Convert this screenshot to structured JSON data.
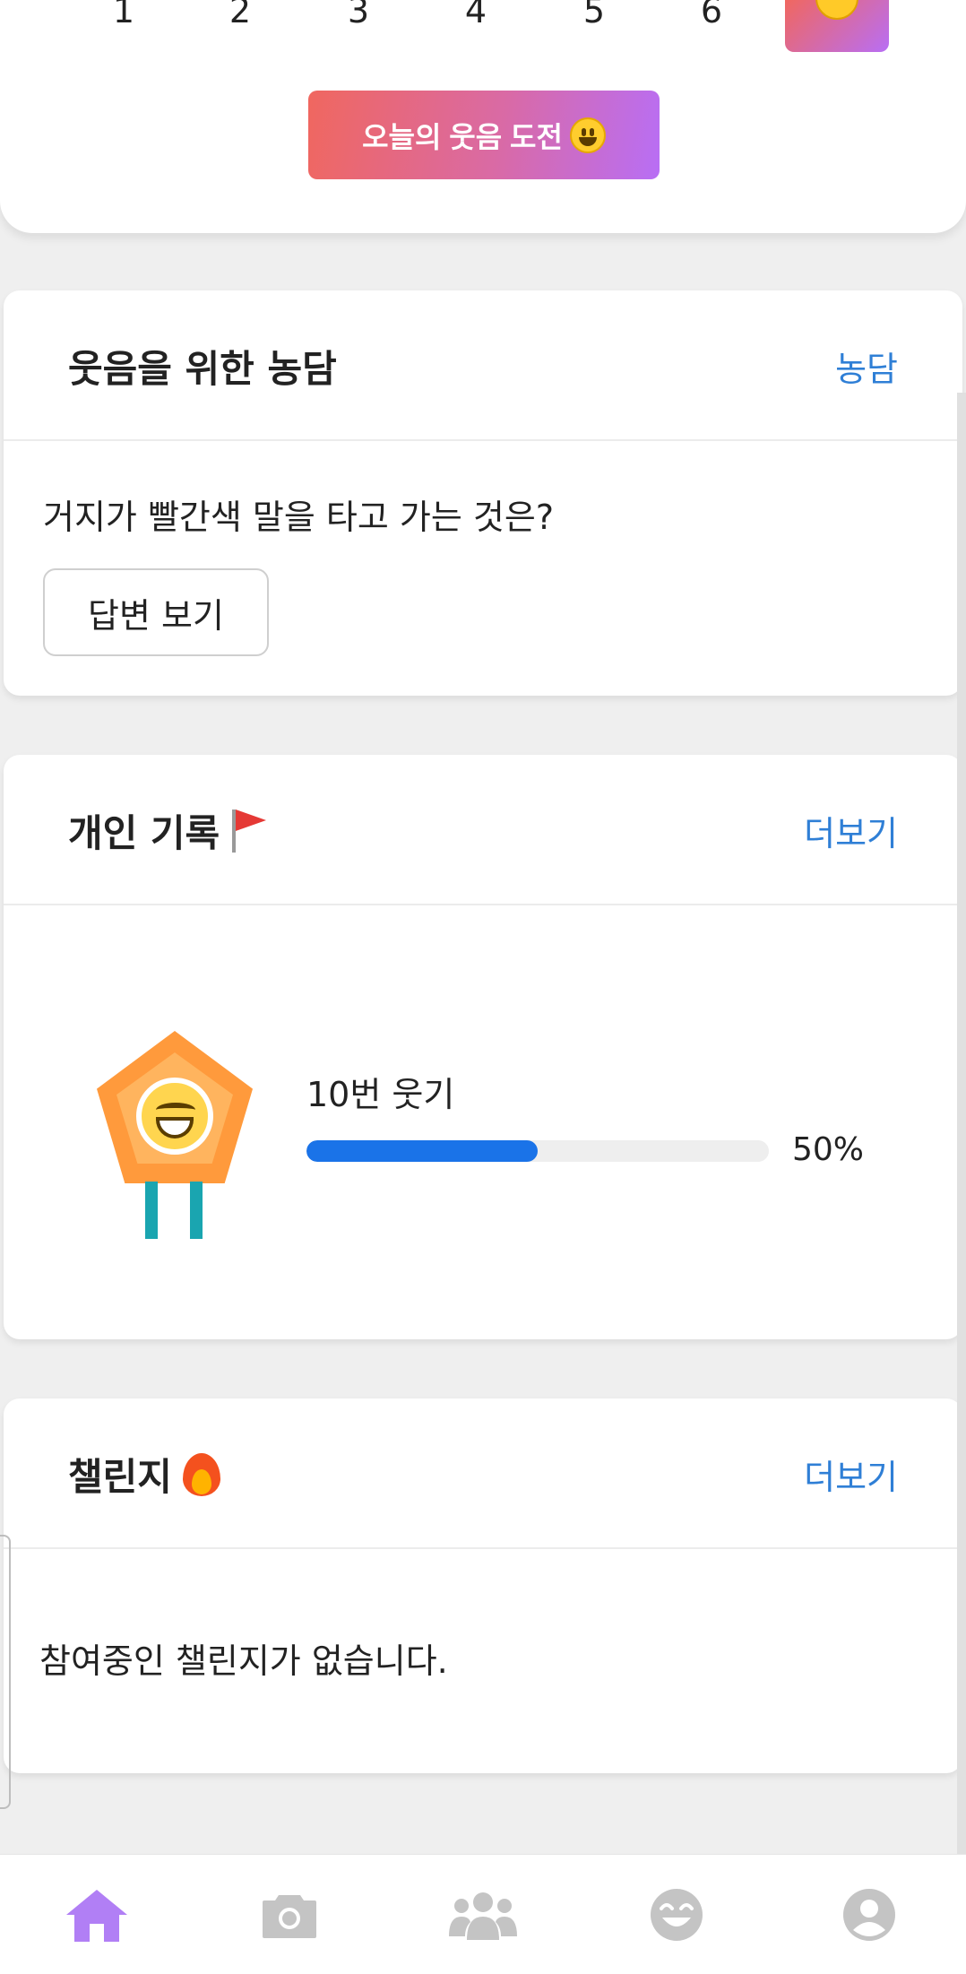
{
  "calendar": {
    "days": [
      "1",
      "2",
      "3",
      "4",
      "5",
      "6"
    ],
    "today_icon": "smiley-face-icon",
    "challenge_button": "오늘의 웃음 도전"
  },
  "joke": {
    "title": "웃음을 위한 농담",
    "link": "농담",
    "question": "거지가 빨간색 말을 타고 가는 것은?",
    "answer_button": "답변 보기"
  },
  "record": {
    "title": "개인 기록",
    "title_icon": "flag-icon",
    "link": "더보기",
    "badge_icon": "smile-medal-icon",
    "goal_label": "10번 웃기",
    "progress_value": 50,
    "progress_text": "50%"
  },
  "challenge": {
    "title": "챌린지",
    "title_icon": "fire-icon",
    "link": "더보기",
    "empty_message": "참여중인 챌린지가 없습니다."
  },
  "bottom_nav": {
    "items": [
      {
        "icon": "home-icon",
        "active": true
      },
      {
        "icon": "camera-icon",
        "active": false
      },
      {
        "icon": "group-icon",
        "active": false
      },
      {
        "icon": "smile-icon",
        "active": false
      },
      {
        "icon": "account-icon",
        "active": false
      }
    ],
    "active_color": "#b17ff5",
    "inactive_color": "#c4c4c4"
  },
  "colors": {
    "link": "#2f7fd6",
    "progress": "#1a73e8",
    "gradient_start": "#f0675f",
    "gradient_end": "#b86ef5"
  }
}
